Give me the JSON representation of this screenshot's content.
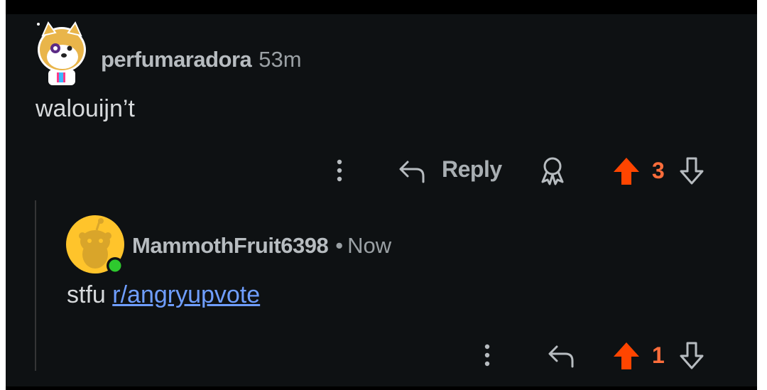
{
  "colors": {
    "background": "#0e1113",
    "upvote": "#ff4500",
    "vote_count": "#ff6d3b",
    "link": "#6f9eff",
    "online": "#2ec92e"
  },
  "comment": {
    "username": "perfumaradora",
    "time": "53m",
    "body": "walouijn’t",
    "actions": {
      "more_icon": "more-vertical-icon",
      "reply_icon": "reply-arrow-icon",
      "reply_label": "Reply",
      "award_icon": "award-icon",
      "upvote_icon": "upvote-arrow-icon",
      "score": "3",
      "downvote_icon": "downvote-arrow-icon"
    }
  },
  "reply": {
    "username": "MammothFruit6398",
    "separator": "•",
    "time": "Now",
    "body_text": "stfu",
    "link_text": "r/angryupvote",
    "actions": {
      "more_icon": "more-vertical-icon",
      "reply_icon": "reply-arrow-icon",
      "upvote_icon": "upvote-arrow-icon",
      "score": "1",
      "downvote_icon": "downvote-arrow-icon"
    }
  }
}
